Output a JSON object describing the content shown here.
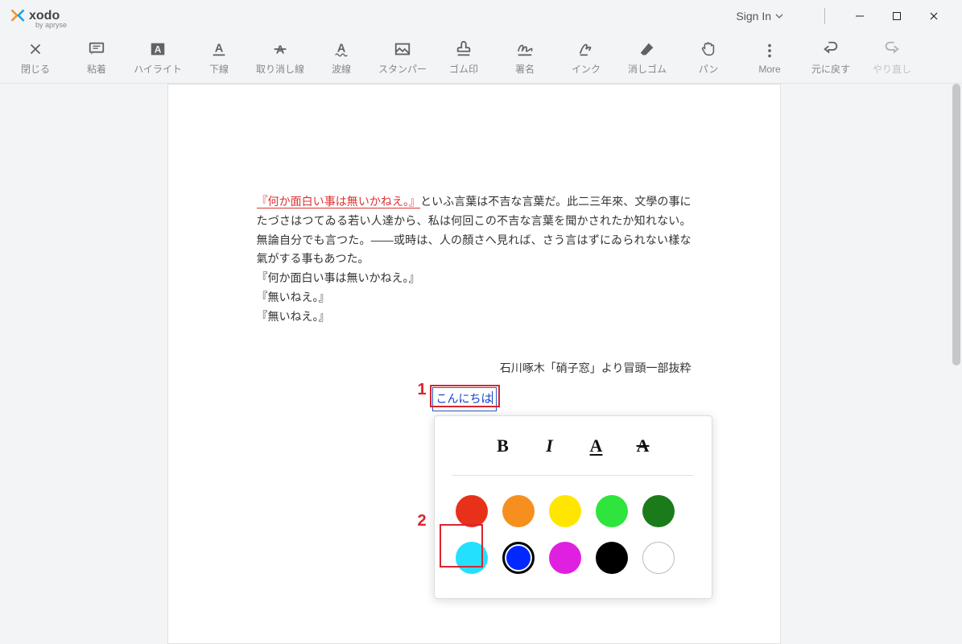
{
  "title": {
    "brand": "xodo",
    "by": "by apryse"
  },
  "sign_in": "Sign In",
  "toolbar": {
    "close": {
      "label": "閉じる"
    },
    "sticky": {
      "label": "粘着"
    },
    "highlight": {
      "label": "ハイライト"
    },
    "underline": {
      "label": "下線"
    },
    "strikeout": {
      "label": "取り消し線"
    },
    "squiggly": {
      "label": "波線"
    },
    "stamper": {
      "label": "スタンパー"
    },
    "stamp": {
      "label": "ゴム印"
    },
    "signature": {
      "label": "署名"
    },
    "ink": {
      "label": "インク"
    },
    "eraser": {
      "label": "消しゴム"
    },
    "pan": {
      "label": "パン"
    },
    "more": {
      "label": "More"
    },
    "undo": {
      "label": "元に戻す"
    },
    "redo": {
      "label": "やり直し"
    }
  },
  "document": {
    "underlined": "『何か面白い事は無いかねえ。』",
    "body": "といふ言葉は不吉な言葉だ。此二三年來、文學の事にたづさはつてゐる若い人達から、私は何回この不吉な言葉を聞かされたか知れない。無論自分でも言つた。——或時は、人の顏さへ見れば、さう言はずにゐられない樣な氣がする事もあつた。",
    "q1": "『何か面白い事は無いかねえ。』",
    "q2": "『無いねえ。』",
    "q3": "『無いねえ。』",
    "attribution": "石川啄木「硝子窓」より冒頭一部抜粋"
  },
  "annotation": {
    "text": "こんにちは"
  },
  "markers": {
    "one": "1",
    "two": "2"
  },
  "format_popup": {
    "bold": "B",
    "italic": "I",
    "underline": "A",
    "strike": "A"
  },
  "colors": {
    "red": "#e8311a",
    "orange": "#f78f1e",
    "yellow": "#ffe600",
    "green": "#2ee43d",
    "dgreen": "#1b7b1b",
    "cyan": "#24e0ff",
    "blue": "#0028ff",
    "magenta": "#e020e0",
    "black": "#000000",
    "white": "#ffffff"
  }
}
